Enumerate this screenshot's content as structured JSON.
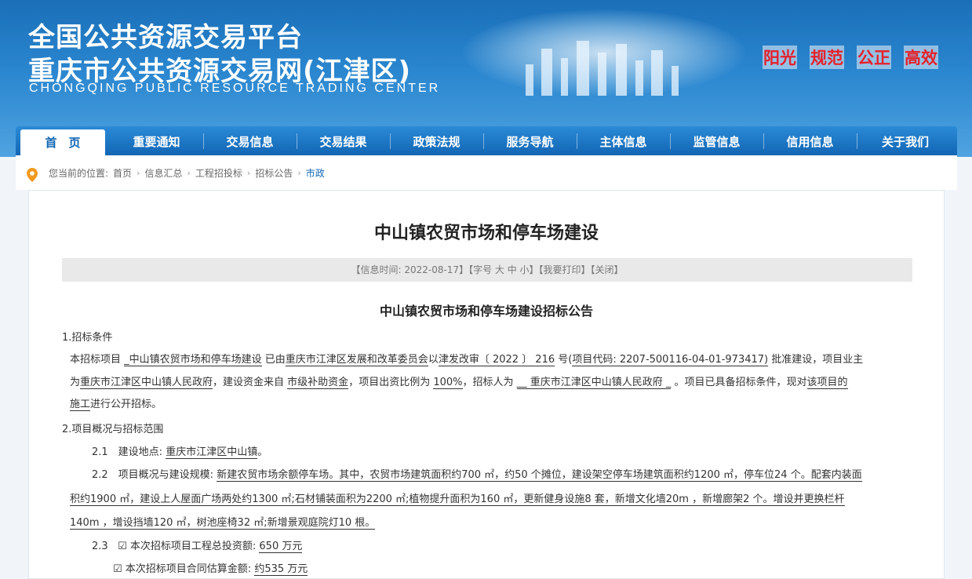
{
  "header": {
    "title_cn": "全国公共资源交易平台",
    "subtitle_cn": "重庆市公共资源交易网(江津区)",
    "subtitle_en": "CHONGQING PUBLIC RESOURCE TRADING CENTER",
    "slogans": [
      "阳光",
      "规范",
      "公正",
      "高效"
    ]
  },
  "nav": {
    "items": [
      "首　页",
      "重要通知",
      "交易信息",
      "交易结果",
      "政策法规",
      "服务导航",
      "主体信息",
      "监管信息",
      "信用信息",
      "关于我们"
    ]
  },
  "breadcrumb": {
    "prefix": "您当前的位置:",
    "items": [
      "首页",
      "信息汇总",
      "工程招投标",
      "招标公告",
      "市政"
    ]
  },
  "article": {
    "title": "中山镇农贸市场和停车场建设",
    "info": "【信息时间: 2022-08-17】【字号 大 中 小】【我要打印】【关闭】",
    "subtitle": "中山镇农贸市场和停车场建设招标公告",
    "sec1_heading": "1.招标条件",
    "sec1": {
      "a": "本招标项目 ",
      "b": "_中山镇农贸市场和停车场建设",
      "c": " 已由",
      "d": "重庆市江津区发展和改革委员会",
      "e": "以",
      "f": "津发改审〔 2022 〕 216",
      "g": " 号(",
      "h": "项目代码: 2207-500116-04-01-973417)",
      "i": " 批准建设，项目业主",
      "j": "为",
      "k": "重庆市江津区中山镇人民政府",
      "l": "，建设资金来自 ",
      "m": "市级补助资金",
      "n": "，项目出资比例为 ",
      "o": "100%",
      "p": "，招标人为 ",
      "q": " __ 重庆市江津区中山镇人民政府 _",
      "r": " 。项目已具备招标条件，现对",
      "s": "该项目的",
      "t": "施工",
      "u": "进行公开招标。"
    },
    "sec2_heading": "2.项目概况与招标范围",
    "s21": {
      "label": "2.1　建设地点: ",
      "value": "重庆市江津区中山镇",
      "end": "。"
    },
    "s22": {
      "label": "2.2　项目概况与建设规模: ",
      "line1": "新建农贸市场余额停车场。其中，农贸市场建筑面积约700 ㎡，约50 个摊位，建设架空停车场建筑面积约1200 ㎡，停车位24 个。配套内装面",
      "line2": "积约1900 ㎡，建设上人屋面广场两处约1300 ㎡;石材铺装面积为2200 ㎡;植物提升面积为160 ㎡，更新健身设施8 套，新增文化墙20m ，新增廊架2 个。增设并更换栏杆",
      "line3": "140m ，增设挡墙120 ㎡，树池座椅32 ㎡;新增景观庭院灯10 根。"
    },
    "s23": {
      "label": "2.3",
      "check": "☑",
      "text1": " 本次招标项目工程总投资额: ",
      "value1": "650 万元",
      "text2": " 本次招标项目合同估算金额: ",
      "value2": "约535 万元"
    }
  },
  "colors": {
    "nav_blue": "#1266b4",
    "slogan_red": "#e6202a"
  }
}
